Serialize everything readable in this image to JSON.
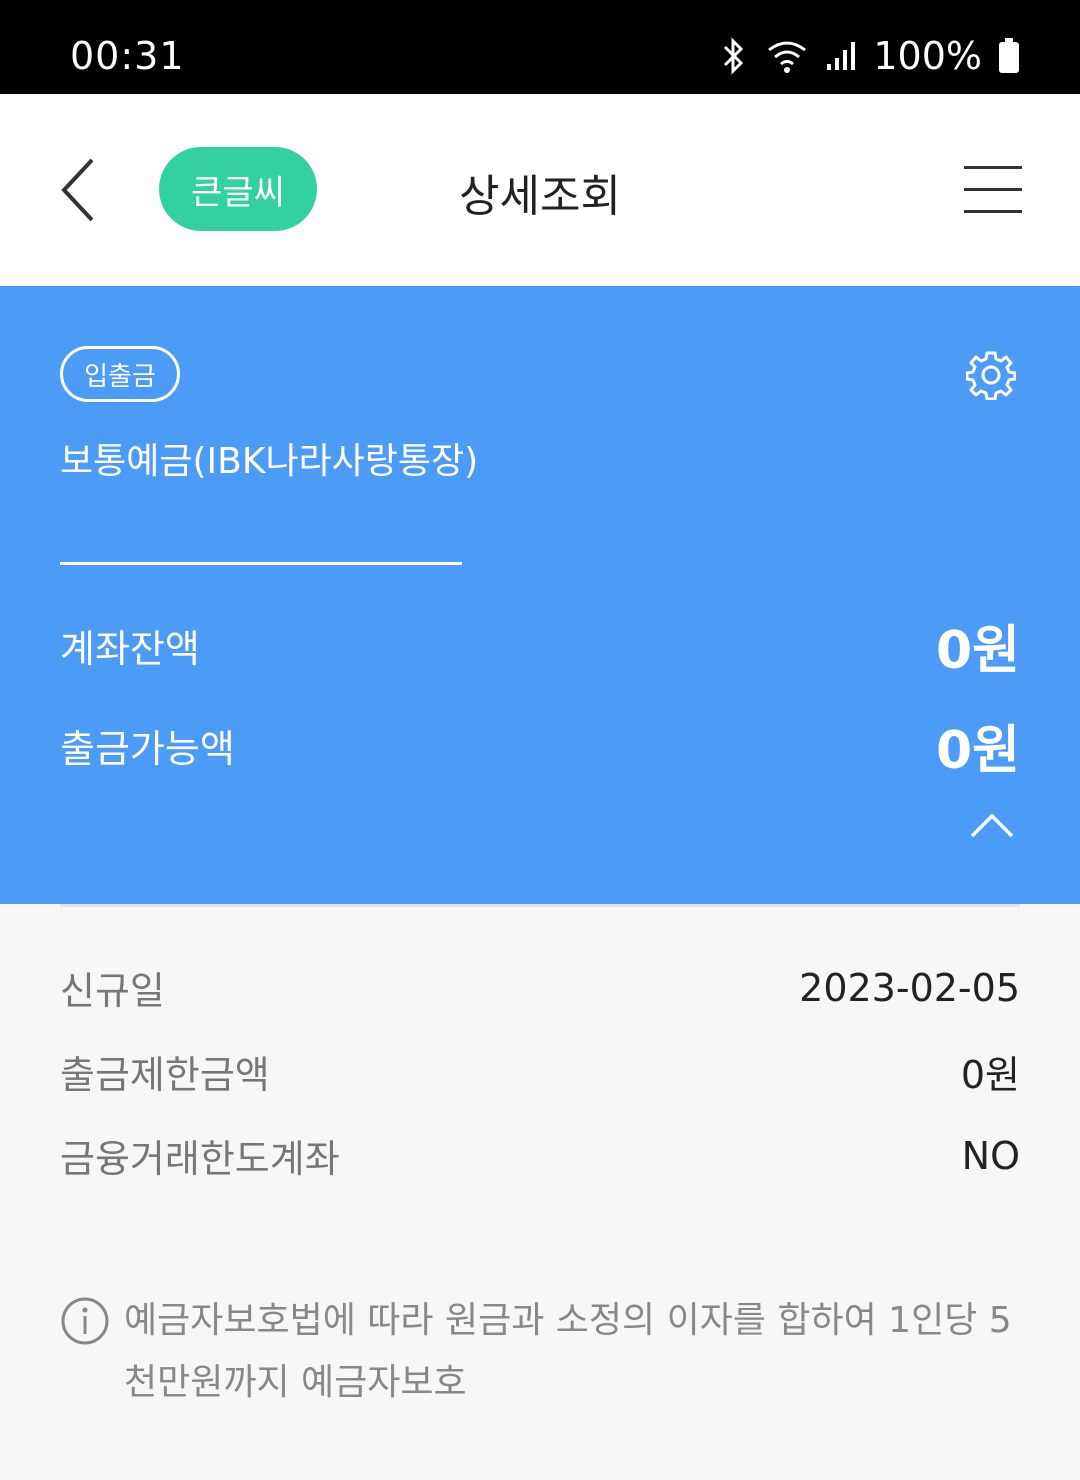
{
  "status_bar": {
    "time": "00:31",
    "battery": "100%",
    "icons": [
      "bluetooth-icon",
      "wifi-icon",
      "signal-icon",
      "battery-icon"
    ]
  },
  "app_bar": {
    "back_icon": "chevron-left-icon",
    "bigfont_label": "큰글씨",
    "title": "상세조회",
    "menu_icon": "hamburger-menu-icon"
  },
  "account": {
    "type_badge": "입출금",
    "name": "보통예금(IBK나라사랑통장)",
    "settings_icon": "gear-icon",
    "balance_label": "계좌잔액",
    "balance_value": "0원",
    "available_label": "출금가능액",
    "available_value": "0원",
    "collapse_icon": "chevron-up-icon"
  },
  "details": [
    {
      "label": "신규일",
      "value": "2023-02-05"
    },
    {
      "label": "출금제한금액",
      "value": "0원"
    },
    {
      "label": "금융거래한도계좌",
      "value": "NO"
    }
  ],
  "notice": {
    "icon": "info-icon",
    "line1": "예금자보호법에 따라 원금과 소정의 이자를 합하여 1인당 5",
    "line2": "천만원까지 예금자보호"
  },
  "colors": {
    "card_bg": "#4c9cf7",
    "bigfont_bg": "#33d1a0",
    "status_bg": "#000000"
  }
}
